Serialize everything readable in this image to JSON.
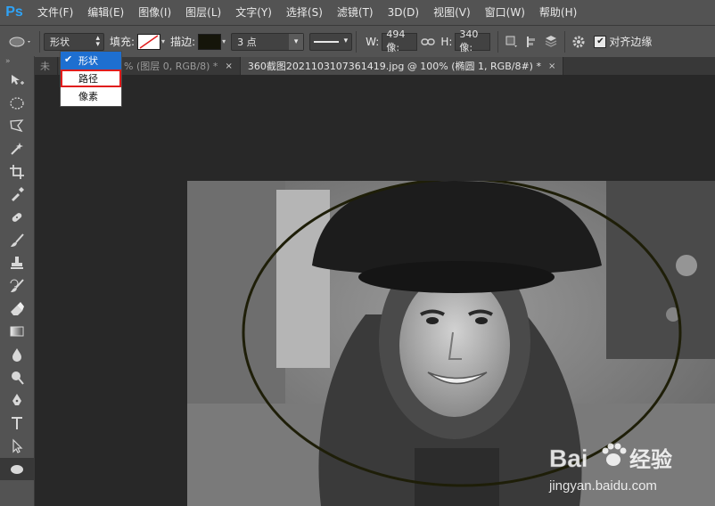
{
  "app": {
    "logo": "Ps"
  },
  "menu": [
    "文件(F)",
    "编辑(E)",
    "图像(I)",
    "图层(L)",
    "文字(Y)",
    "选择(S)",
    "滤镜(T)",
    "3D(D)",
    "视图(V)",
    "窗口(W)",
    "帮助(H)"
  ],
  "options": {
    "mode_value": "形状",
    "fill_label": "填充:",
    "stroke_label": "描边:",
    "stroke_size": "3 点",
    "w_label": "W:",
    "w_value": "494 像:",
    "h_label": "H:",
    "h_value": "340 像:",
    "align_edges_label": "对齐边缘",
    "align_edges_checked": true,
    "stroke_color": "#2b2b12",
    "fill_color": "#ffffff"
  },
  "mode_dropdown": {
    "items": [
      {
        "label": "形状",
        "selected": true,
        "highlighted": false
      },
      {
        "label": "路径",
        "selected": false,
        "highlighted": true
      },
      {
        "label": "像素",
        "selected": false,
        "highlighted": false
      }
    ]
  },
  "tabs": [
    {
      "label": "未",
      "active": false,
      "close": ""
    },
    {
      "label": "% (图层 0, RGB/8) *",
      "active": false,
      "close": "×"
    },
    {
      "label": "360截图20211031073614​19.jpg @ 100% (椭圆 1, RGB/8#) *",
      "active": true,
      "close": "×"
    }
  ],
  "tools": [
    "move-tool",
    "marquee-tool",
    "lasso-tool",
    "magic-wand-tool",
    "crop-tool",
    "eyedropper-tool",
    "healing-tool",
    "brush-tool",
    "stamp-tool",
    "history-brush-tool",
    "eraser-tool",
    "gradient-tool",
    "blur-tool",
    "dodge-tool",
    "pen-tool",
    "type-tool",
    "path-select-tool",
    "ellipse-tool"
  ],
  "watermark": {
    "brand_left": "Bai",
    "brand_right": "经验",
    "url": "jingyan.baidu.com"
  },
  "colors": {
    "panel": "#535353",
    "canvas_bg": "#282828",
    "accent": "#1e6fd0",
    "highlight_box": "#e01c1c"
  }
}
